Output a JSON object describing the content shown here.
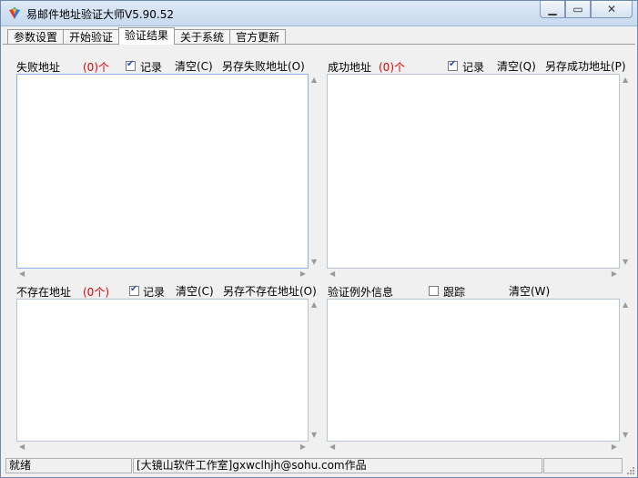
{
  "window": {
    "title": "易邮件地址验证大师V5.90.52",
    "controls": {
      "minimize": "▁",
      "maximize": "▭",
      "close": "✕"
    }
  },
  "tabs": [
    {
      "label": "参数设置"
    },
    {
      "label": "开始验证"
    },
    {
      "label": "验证结果",
      "active": true
    },
    {
      "label": "关于系统"
    },
    {
      "label": "官方更新"
    }
  ],
  "failed": {
    "title": "失败地址",
    "count": "(0)个",
    "record_label": "记录",
    "record_checked": true,
    "clear_label": "清空(C)",
    "save_label": "另存失败地址(O)"
  },
  "success": {
    "title": "成功地址",
    "count": "(0)个",
    "record_label": "记录",
    "record_checked": true,
    "clear_label": "清空(Q)",
    "save_label": "另存成功地址(P)"
  },
  "nonexist": {
    "title": "不存在地址",
    "count": "(0个)",
    "record_label": "记录",
    "record_checked": true,
    "clear_label": "清空(C)",
    "save_label": "另存不存在地址(O)"
  },
  "exception": {
    "title": "验证例外信息",
    "trace_label": "跟踪",
    "trace_checked": false,
    "clear_label": "清空(W)"
  },
  "status": {
    "state": "就绪",
    "credit": "[大镜山软件工作室]gxwclhjh@sohu.com作品"
  },
  "colors": {
    "count_red": "#e00000"
  }
}
